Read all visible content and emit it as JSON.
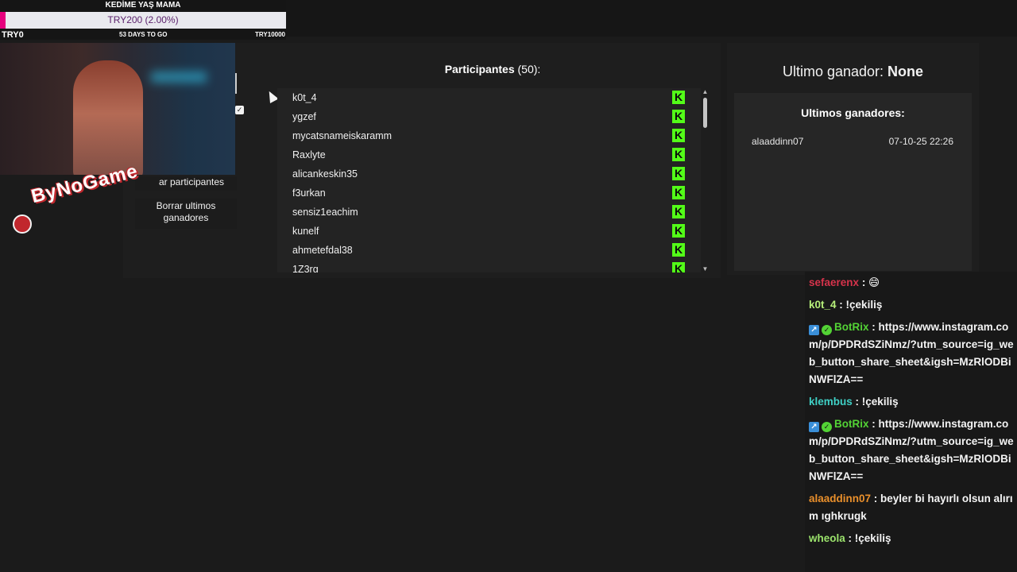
{
  "goal": {
    "title": "KEDİME YAŞ MAMA",
    "percent_text": "TRY200 (2.00%)",
    "progress": 0.02,
    "current": "TRY0",
    "days_left": "53 DAYS TO GO",
    "target": "TRY10000",
    "fill_color": "#e6007e"
  },
  "overlay": {
    "logo_text": "ByNoGame"
  },
  "controls": {
    "show_participants_label": "ar participantes",
    "clear_winners_label": "Borrar ultimos ganadores",
    "checkbox_checked": true
  },
  "participants": {
    "title": "Participantes",
    "count": "(50):",
    "platform_icon": "kick-icon",
    "kick_color": "#53fc18",
    "names": [
      "k0t_4",
      "ygzef",
      "mycatsnameiskaramm",
      "Raxlyte",
      "alicankeskin35",
      "f3urkan",
      "sensiz1eachim",
      "kunelf",
      "ahmetefdal38",
      "1Z3rg"
    ]
  },
  "winner": {
    "label": "Ultimo ganador:",
    "value": "None",
    "history_title": "Ultimos ganadores:",
    "history": [
      {
        "name": "alaaddinn07",
        "date": "07-10-25 22:26"
      }
    ]
  },
  "chat": {
    "messages": [
      {
        "user": "sefaerenx",
        "color": "#d6334b",
        "text": ": 😄",
        "badges": []
      },
      {
        "user": "k0t_4",
        "color": "#b7f07a",
        "text": ": !çekiliş",
        "badges": []
      },
      {
        "user": "BotRix",
        "color": "#53d335",
        "text": ": https://www.instagram.com/p/DPDRdSZiNmz/?utm_source=ig_web_button_share_sheet&igsh=MzRlODBiNWFlZA==",
        "badges": [
          "bot",
          "verified"
        ]
      },
      {
        "user": "klembus",
        "color": "#3fd1c6",
        "text": ": !çekiliş",
        "badges": []
      },
      {
        "user": "BotRix",
        "color": "#53d335",
        "text": ": https://www.instagram.com/p/DPDRdSZiNmz/?utm_source=ig_web_button_share_sheet&igsh=MzRlODBiNWFlZA==",
        "badges": [
          "bot",
          "verified"
        ]
      },
      {
        "user": "alaaddinn07",
        "color": "#e98f2b",
        "text": ": beyler bi hayırlı olsun alırım ıghkrugk",
        "badges": []
      },
      {
        "user": "wheola",
        "color": "#9be36c",
        "text": ": !çekiliş",
        "badges": []
      }
    ]
  }
}
